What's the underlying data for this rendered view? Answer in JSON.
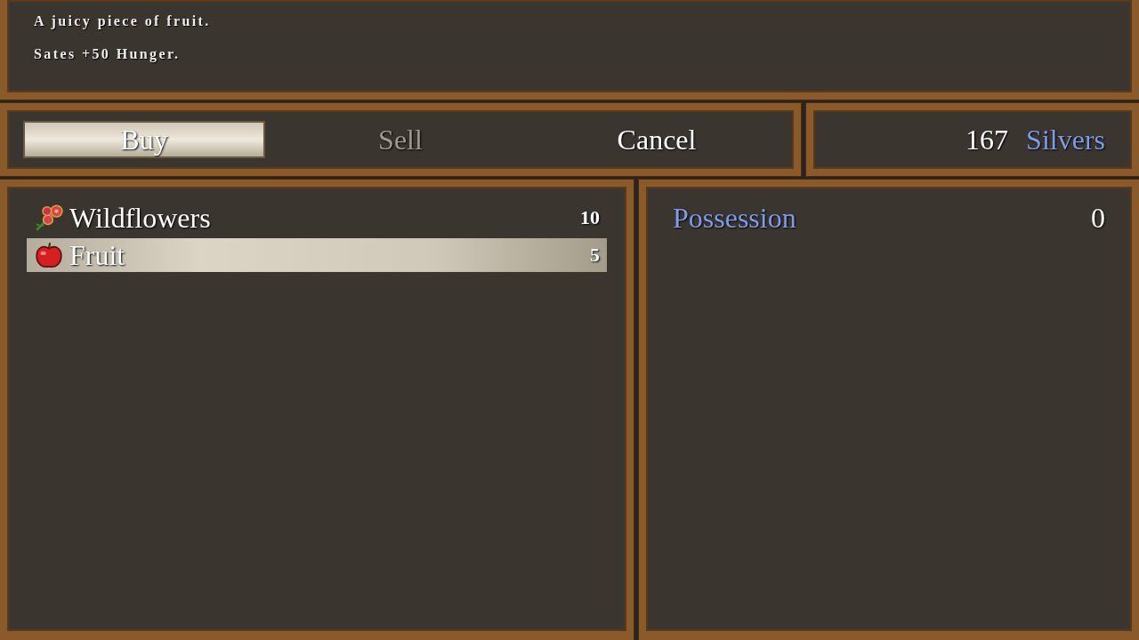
{
  "help": {
    "lines": [
      "A juicy piece of fruit.",
      "Sates +50 Hunger."
    ]
  },
  "commands": [
    {
      "label": "Buy",
      "selected": true,
      "disabled": false
    },
    {
      "label": "Sell",
      "selected": false,
      "disabled": true
    },
    {
      "label": "Cancel",
      "selected": false,
      "disabled": false
    }
  ],
  "gold": {
    "amount": "167",
    "unit": "Silvers"
  },
  "items": [
    {
      "name": "Wildflowers",
      "kind": "flower",
      "price": "10",
      "selected": false
    },
    {
      "name": "Fruit",
      "kind": "apple",
      "price": "5",
      "selected": true
    }
  ],
  "status": {
    "label": "Possession",
    "value": "0"
  }
}
